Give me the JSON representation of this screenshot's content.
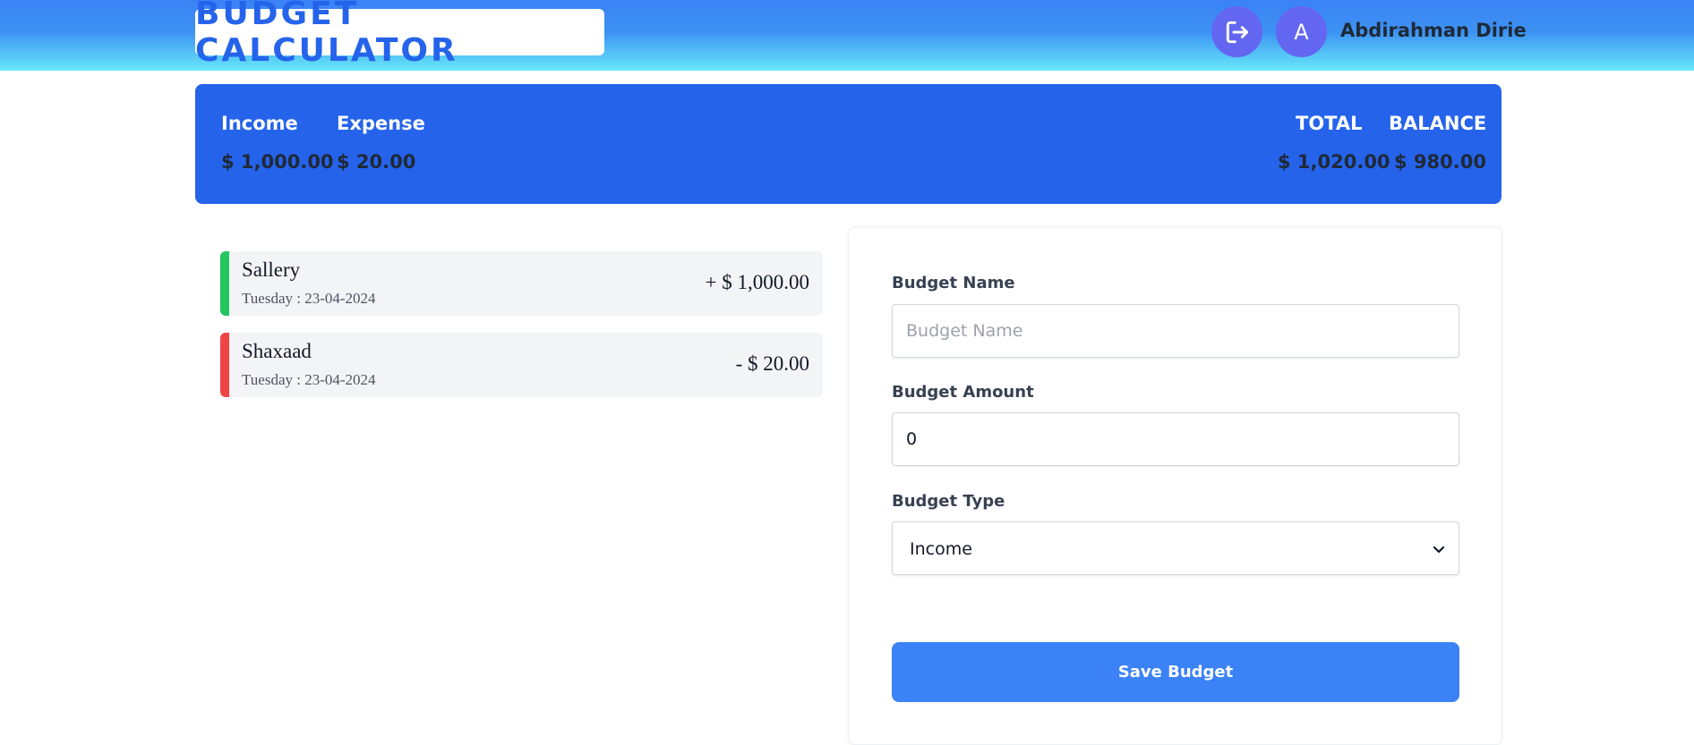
{
  "header": {
    "logo": "BUDGET CALCULATOR",
    "logout_icon": "logout-icon",
    "avatar_initial": "A",
    "user_name": "Abdirahman Dirie"
  },
  "summary": {
    "income_label": "Income",
    "income_value": "$ 1,000.00",
    "expense_label": "Expense",
    "expense_value": "$ 20.00",
    "total_label": "TOTAL",
    "total_value": "$ 1,020.00",
    "balance_label": "BALANCE",
    "balance_value": "$ 980.00"
  },
  "entries": [
    {
      "name": "Sallery",
      "date": "Tuesday : 23-04-2024",
      "amount": "+ $ 1,000.00",
      "type": "income",
      "color": "#22c55e"
    },
    {
      "name": "Shaxaad",
      "date": "Tuesday : 23-04-2024",
      "amount": "- $ 20.00",
      "type": "expense",
      "color": "#ef4444"
    }
  ],
  "form": {
    "name_label": "Budget Name",
    "name_placeholder": "Budget Name",
    "amount_label": "Budget Amount",
    "amount_value": "0",
    "type_label": "Budget Type",
    "type_selected": "Income",
    "save_label": "Save Budget"
  },
  "colors": {
    "primary": "#2563eb",
    "button": "#3b82f6",
    "avatar": "#6366f1",
    "income": "#22c55e",
    "expense": "#ef4444"
  }
}
